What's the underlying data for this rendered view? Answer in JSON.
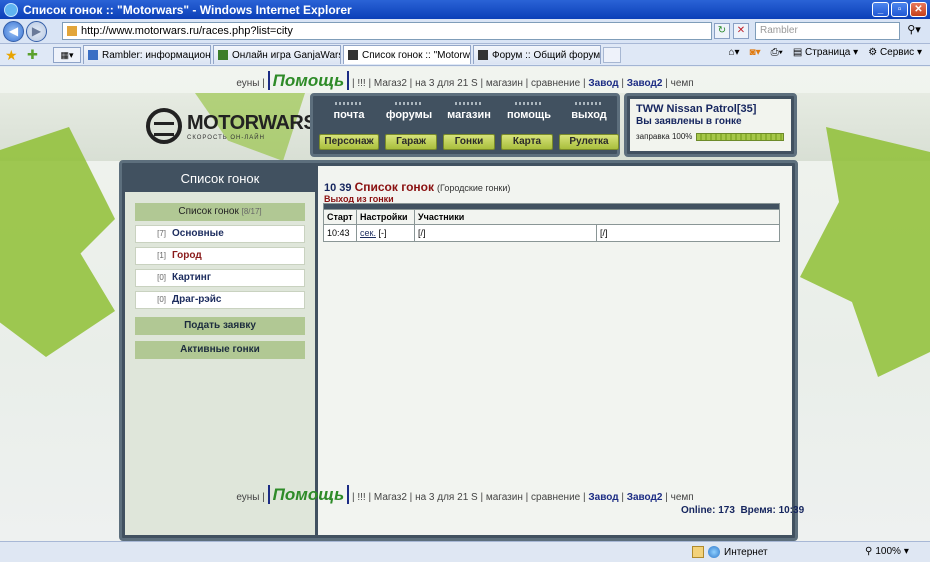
{
  "browser": {
    "window_title": "Список гонок :: \"Motorwars\" - Windows Internet Explorer",
    "address": "http://www.motorwars.ru/races.php?list=city",
    "search_placeholder": "Rambler",
    "tabs": [
      {
        "label": "Rambler: информационно-п...",
        "active": false
      },
      {
        "label": "Онлайн игра GanjaWars.Ru ...",
        "active": false
      },
      {
        "label": "Список гонок :: \"Motorw...",
        "active": true
      },
      {
        "label": "Форум :: Общий форум :: \"...",
        "active": false
      }
    ],
    "cmd_page": "Страница",
    "cmd_service": "Сервис",
    "status_zone": "Интернет",
    "zoom": "100%"
  },
  "topnav": {
    "item1": "еуны",
    "help": "Помощь",
    "excl": "!!!",
    "magaz2": "Магаз2",
    "three_for": "на 3 для 21 S",
    "shop": "магазин",
    "compare": "сравнение",
    "factory": "Завод",
    "factory2": "Завод2",
    "champ": "чемп"
  },
  "logo": {
    "title": "MOTORWARS.RU",
    "subtitle": "СКОРОСТЬ ОН-ЛАЙН"
  },
  "menu": {
    "top": [
      "почта",
      "форумы",
      "магазин",
      "помощь",
      "выход"
    ],
    "bottom": [
      "Персонаж",
      "Гараж",
      "Гонки",
      "Карта",
      "Рулетка"
    ]
  },
  "status": {
    "car": "TWW Nissan Patrol[35]",
    "text": "Вы заявлены в гонке",
    "fuel_label": "заправка 100%",
    "fuel_percent": 100
  },
  "left": {
    "header": "Список гонок",
    "list_head": "Список гонок",
    "list_count": "[8/17]",
    "items": [
      {
        "num": "[7]",
        "name": "Основные",
        "active": false
      },
      {
        "num": "[1]",
        "name": "Город",
        "active": true
      },
      {
        "num": "[0]",
        "name": "Картинг",
        "active": false
      },
      {
        "num": "[0]",
        "name": "Драг-рэйс",
        "active": false
      }
    ],
    "apply_button": "Подать заявку",
    "active_races_button": "Активные гонки"
  },
  "main": {
    "time": "10 39",
    "title": "Список гонок",
    "subtitle": "(Городские гонки)",
    "exit_link": "Выход из гонки",
    "table": {
      "headers": [
        "Старт",
        "Настройки",
        "Участники"
      ],
      "rows": [
        {
          "start": "10:43",
          "settings_link": "сек.",
          "settings_extra": "[-]",
          "p1": "[/]",
          "p2": "[/]"
        }
      ]
    }
  },
  "footer": {
    "online": "Online: 173  Время: 10:39"
  }
}
